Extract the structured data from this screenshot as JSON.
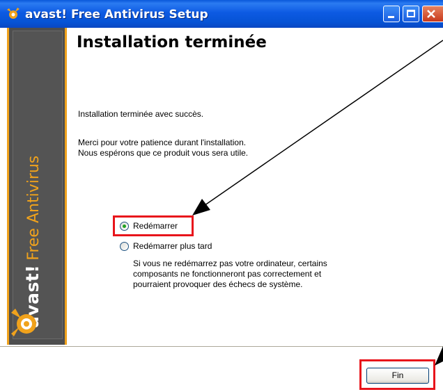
{
  "window": {
    "title": "avast! Free Antivirus Setup"
  },
  "sidebar": {
    "brand": "avast!",
    "product": "Free Antivirus"
  },
  "main": {
    "heading": "Installation terminée",
    "success_text": "Installation terminée avec succès.",
    "thanks_line1": "Merci pour votre patience durant l'installation.",
    "thanks_line2": "Nous espérons que ce produit vous sera utile."
  },
  "options": {
    "restart_now": {
      "label": "Redémarrer",
      "selected": true
    },
    "restart_later": {
      "label": "Redémarrer plus tard",
      "selected": false,
      "note_line1": "Si vous ne redémarrez pas votre ordinateur, certains",
      "note_line2": "composants ne fonctionneront pas correctement et",
      "note_line3": "pourraient provoquer des échecs de système."
    }
  },
  "footer": {
    "finish_label": "Fin"
  },
  "colors": {
    "titlebar": "#0A58DA",
    "accent_orange": "#F0A21C",
    "highlight_red": "#E8141B",
    "radio_green": "#21A121"
  }
}
